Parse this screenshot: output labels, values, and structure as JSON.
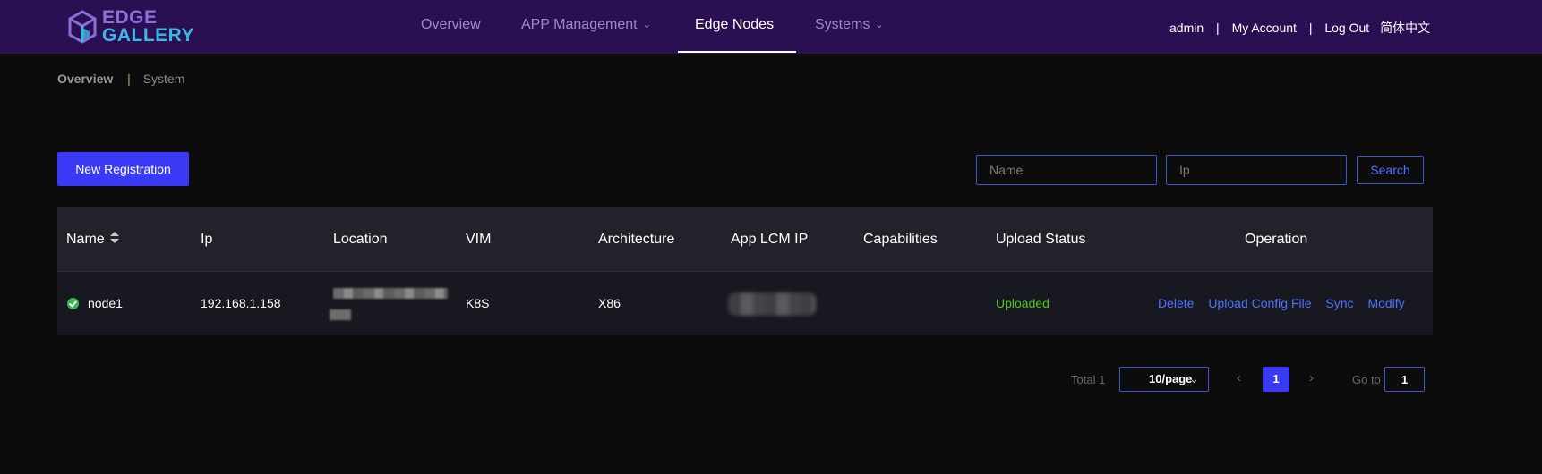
{
  "logo": {
    "line1": "EDGE",
    "line2": "GALLERY"
  },
  "nav": {
    "items": [
      {
        "label": "Overview",
        "dropdown": false,
        "active": false
      },
      {
        "label": "APP Management",
        "dropdown": true,
        "active": false
      },
      {
        "label": "Edge Nodes",
        "dropdown": false,
        "active": true
      },
      {
        "label": "Systems",
        "dropdown": true,
        "active": false
      }
    ]
  },
  "user": {
    "name": "admin",
    "separator": "|",
    "my_account": "My Account",
    "logout": "Log Out",
    "language": "简体中文"
  },
  "breadcrumb": {
    "first": "Overview",
    "separator": "|",
    "second": "System"
  },
  "toolbar": {
    "new_label": "New Registration",
    "name_placeholder": "Name",
    "ip_placeholder": "Ip",
    "search_label": "Search"
  },
  "table": {
    "headers": [
      "Name",
      "Ip",
      "Location",
      "VIM",
      "Architecture",
      "App LCM IP",
      "Capabilities",
      "Upload Status",
      "Operation"
    ],
    "rows": [
      {
        "name": "node1",
        "ip": "192.168.1.158",
        "vim": "K8S",
        "architecture": "X86",
        "capabilities": "",
        "upload_status": "Uploaded",
        "operations": [
          "Delete",
          "Upload Config File",
          "Sync",
          "Modify"
        ]
      }
    ]
  },
  "pagination": {
    "total_label": "Total 1",
    "page_size": "10/page",
    "current_page": "1",
    "goto_label": "Go to",
    "goto_value": "1"
  },
  "colors": {
    "topbar": "#2a0f52",
    "accent": "#3a3af5",
    "success": "#52c41a",
    "link": "#4f72ff"
  }
}
